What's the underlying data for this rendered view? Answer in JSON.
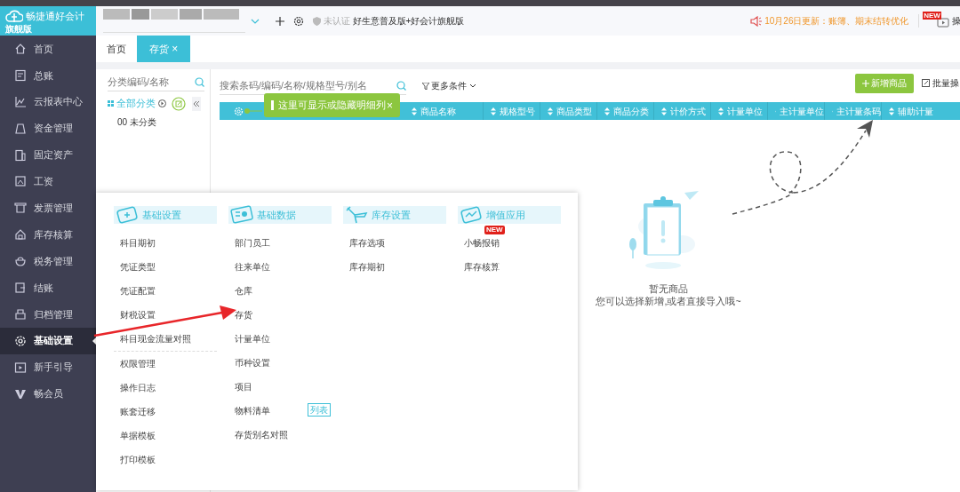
{
  "app": {
    "name": "畅捷通好会计",
    "edition": "旗舰版"
  },
  "header": {
    "cert": "未认证",
    "product": "好生意普及版+好会计旗舰版",
    "notice": "10月26日更新：账簿、期末结转优化",
    "help_badge": "NEW",
    "help": "操"
  },
  "tabs": [
    {
      "label": "首页",
      "selected": false
    },
    {
      "label": "存货",
      "selected": true,
      "close": "×"
    }
  ],
  "sidebar": {
    "items": [
      {
        "label": "首页",
        "selected": false
      },
      {
        "label": "总账",
        "selected": false
      },
      {
        "label": "云报表中心",
        "selected": false
      },
      {
        "label": "资金管理",
        "selected": false
      },
      {
        "label": "固定资产",
        "selected": false
      },
      {
        "label": "工资",
        "selected": false
      },
      {
        "label": "发票管理",
        "selected": false
      },
      {
        "label": "库存核算",
        "selected": false
      },
      {
        "label": "税务管理",
        "selected": false
      },
      {
        "label": "结账",
        "selected": false
      },
      {
        "label": "归档管理",
        "selected": false
      },
      {
        "label": "基础设置",
        "selected": true
      },
      {
        "label": "新手引导",
        "selected": false
      },
      {
        "label": "畅会员",
        "selected": false
      }
    ]
  },
  "category_panel": {
    "placeholder": "分类编码/名称",
    "root": "全部分类",
    "items": [
      "00 未分类"
    ]
  },
  "toolbar": {
    "placeholder": "搜索条码/编码/名称/规格型号/别名",
    "filter": "更多条件",
    "add_button": "新增商品",
    "batch": "批量操"
  },
  "table": {
    "columns": [
      "商品名称",
      "规格型号",
      "商品类型",
      "商品分类",
      "计价方式",
      "计量单位",
      "主计量单位",
      "主计量条码",
      "辅助计量"
    ]
  },
  "tooltip": {
    "text": "这里可显示或隐藏明细列",
    "close": "×"
  },
  "empty": {
    "title": "暂无商品",
    "hint": "您可以选择新增,或者直接导入哦~"
  },
  "mega_menu": {
    "sections": [
      {
        "title": "基础设置",
        "groups": [
          [
            {
              "label": "科目期初"
            },
            {
              "label": "凭证类型"
            },
            {
              "label": "凭证配置"
            },
            {
              "label": "财税设置"
            },
            {
              "label": "科目现金流量对照"
            }
          ],
          [
            {
              "label": "权限管理"
            },
            {
              "label": "操作日志"
            },
            {
              "label": "账套迁移"
            },
            {
              "label": "单据模板"
            },
            {
              "label": "打印模板"
            }
          ]
        ]
      },
      {
        "title": "基础数据",
        "groups": [
          [
            {
              "label": "部门员工"
            },
            {
              "label": "往来单位"
            },
            {
              "label": "仓库"
            },
            {
              "label": "存货"
            },
            {
              "label": "计量单位"
            },
            {
              "label": "币种设置"
            },
            {
              "label": "项目"
            },
            {
              "label": "物料清单",
              "badge": "列表",
              "kind": "list"
            },
            {
              "label": "存货别名对照"
            }
          ]
        ]
      },
      {
        "title": "库存设置",
        "groups": [
          [
            {
              "label": "库存选项"
            },
            {
              "label": "库存期初"
            }
          ]
        ]
      },
      {
        "title": "增值应用",
        "groups": [
          [
            {
              "label": "小畅报销",
              "badge": "NEW",
              "kind": "new"
            },
            {
              "label": "库存核算"
            }
          ]
        ]
      }
    ]
  }
}
